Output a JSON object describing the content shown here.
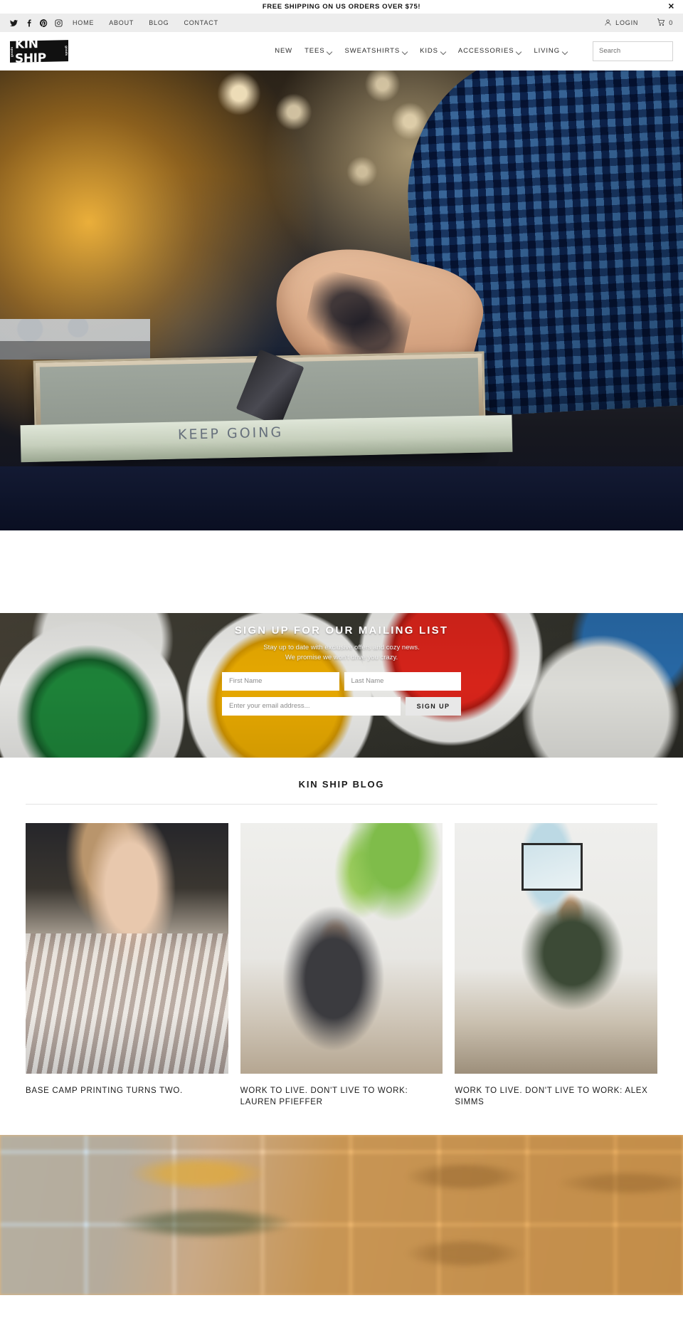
{
  "announcement": {
    "text": "FREE SHIPPING ON US ORDERS OVER $75!",
    "close_label": "✕"
  },
  "utility_nav": {
    "social": [
      {
        "name": "twitter-icon",
        "label": "Twitter"
      },
      {
        "name": "facebook-icon",
        "label": "Facebook"
      },
      {
        "name": "pinterest-icon",
        "label": "Pinterest"
      },
      {
        "name": "instagram-icon",
        "label": "Instagram"
      }
    ],
    "links": [
      {
        "label": "HOME"
      },
      {
        "label": "ABOUT"
      },
      {
        "label": "BLOG"
      },
      {
        "label": "CONTACT"
      }
    ],
    "login_label": "LOGIN",
    "cart_count": "0"
  },
  "header": {
    "logo": {
      "main": "KIN SHIP",
      "left_small": "goods",
      "right_small": "goods"
    },
    "menu": [
      {
        "label": "NEW",
        "has_dropdown": false
      },
      {
        "label": "TEES",
        "has_dropdown": true
      },
      {
        "label": "SWEATSHIRTS",
        "has_dropdown": true
      },
      {
        "label": "KIDS",
        "has_dropdown": true
      },
      {
        "label": "ACCESSORIES",
        "has_dropdown": true
      },
      {
        "label": "LIVING",
        "has_dropdown": true
      }
    ],
    "search": {
      "placeholder": "Search",
      "value": "",
      "icon": "search-icon"
    }
  },
  "hero": {
    "alt": "Screen printer pulling a squeegee across a screen in a print shop",
    "screen_text": "KEEP GOING"
  },
  "newsletter": {
    "title": "SIGN UP FOR OUR MAILING LIST",
    "subtitle_line1": "Stay up to date with exclusive offers and cozy news.",
    "subtitle_line2": "We promise we won't drive you crazy.",
    "first_name_placeholder": "First Name",
    "first_name_value": "",
    "last_name_placeholder": "Last Name",
    "last_name_value": "",
    "email_placeholder": "Enter your email address...",
    "email_value": "",
    "submit_label": "SIGN UP"
  },
  "blog": {
    "heading": "KIN SHIP BLOG",
    "posts": [
      {
        "title": "BASE CAMP PRINTING TURNS TWO.",
        "alt": "Woman in striped shirt and apron working at a press"
      },
      {
        "title": "WORK TO LIVE. DON'T LIVE TO WORK: LAUREN PFIEFFER",
        "alt": "Person seated on floor with hanging plants and a cat"
      },
      {
        "title": "WORK TO LIVE. DON'T LIVE TO WORK: ALEX SIMMS",
        "alt": "Person in beanie seated with a camera beside framed art"
      }
    ]
  },
  "bottom_banner": {
    "alt": "Blurred photo of stacked wooden stamp boxes"
  },
  "colors": {
    "announcement_bg": "#ffffff",
    "utility_bg": "#ededed",
    "text_dark": "#1a1a1a",
    "text_muted": "#3c3c3c",
    "border": "#d3d3d3",
    "button_bg": "#e8e8e8",
    "logo_bg": "#111111"
  }
}
